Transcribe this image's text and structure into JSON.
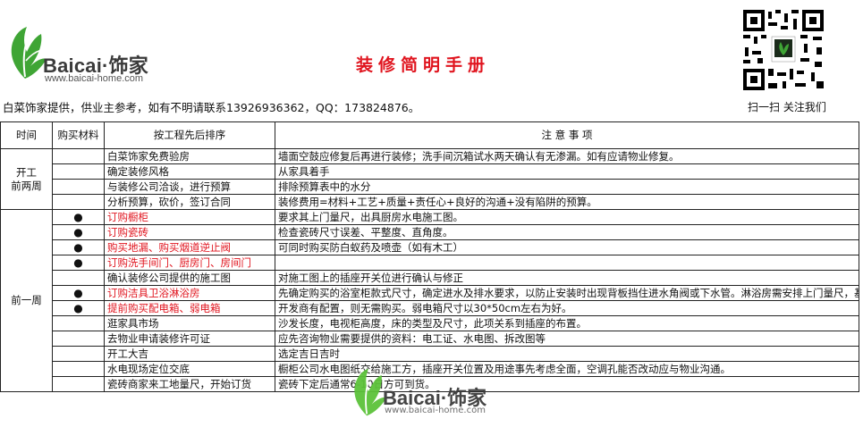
{
  "header": {
    "logo_text": "Baicai·饰家",
    "logo_url": "www.baicai-home.com",
    "title": "装修简明手册",
    "provider_note": "白菜饰家提供，供业主参考，如有不明请联系13926936362，QQ：173824876。",
    "qr_caption": "扫一扫 关注我们"
  },
  "table": {
    "headers": [
      "时间",
      "购买材料",
      "按工程先后排序",
      "注 意 事 项"
    ],
    "periods": [
      "开工\n前两周",
      "前一周"
    ],
    "rows": [
      {
        "purchase": false,
        "item": "白菜饰家免费验房",
        "red": false,
        "note": "墙面空鼓应修复后再进行装修；洗手间沉箱试水两天确认有无渗漏。如有应请物业修复。"
      },
      {
        "purchase": false,
        "item": "确定装修风格",
        "red": false,
        "note": "从家具着手"
      },
      {
        "purchase": false,
        "item": "与装修公司洽谈，进行预算",
        "red": false,
        "note": "排除预算表中的水分"
      },
      {
        "purchase": false,
        "item": "分析预算，砍价，签订合同",
        "red": false,
        "note": "装修费用=材料+工艺+质量+责任心+良好的沟通+没有陷阱的预算。"
      },
      {
        "purchase": true,
        "item": "订购橱柜",
        "red": true,
        "note": "要求其上门量尺，出具厨房水电施工图。"
      },
      {
        "purchase": true,
        "item": "订购瓷砖",
        "red": true,
        "note": "检查瓷砖尺寸误差、平整度、直角度。"
      },
      {
        "purchase": true,
        "item": "购买地漏、购买烟道逆止阀",
        "red": true,
        "note": "可同时购买防白蚁药及喷壶（如有木工）"
      },
      {
        "purchase": true,
        "item": "订购洗手间门、厨房门、房间门",
        "red": true,
        "note": ""
      },
      {
        "purchase": false,
        "item": "确认装修公司提供的施工图",
        "red": false,
        "note": "对施工图上的插座开关位进行确认与修正"
      },
      {
        "purchase": true,
        "item": "订购洁具卫浴淋浴房",
        "red": true,
        "note": "先确定购买的浴室柜款式尺寸，确定进水及排水要求，以防止安装时出现背板挡住进水角阀或下水管。淋浴房需安排上门量尺，基石要预先安排制作。"
      },
      {
        "purchase": true,
        "item": "提前购买配电箱、弱电箱",
        "red": true,
        "note": "开发商有配置，则无需购买。弱电箱尺寸以30*50cm左右为好。"
      },
      {
        "purchase": false,
        "item": "逛家具市场",
        "red": false,
        "note": "沙发长度，电视柜高度，床的类型及尺寸，此项关系到插座的布置。"
      },
      {
        "purchase": false,
        "item": "去物业申请装修许可证",
        "red": false,
        "note": "应先咨询物业需要提供的资料：电工证、水电图、拆改图等"
      },
      {
        "purchase": false,
        "item": "开工大吉",
        "red": false,
        "note": "选定吉日吉时"
      },
      {
        "purchase": false,
        "item": "水电现场定位交底",
        "red": false,
        "note": "橱柜公司水电图纸交给施工方，插座开关位置及用途事先考虑全面，空调孔能否改动应与物业沟通。"
      },
      {
        "purchase": false,
        "item": "瓷砖商家来工地量尺，开始订货",
        "red": false,
        "note": "瓷砖下定后通常6-10日方可到货。"
      }
    ]
  },
  "watermark": {
    "text": "Baicai·饰家",
    "url": "www.baicai-home.com"
  },
  "colors": {
    "title": "#e0141e",
    "logo_green": "#3fa535",
    "text": "#111111"
  },
  "icons": {
    "logo": "cabbage-leaf-icon",
    "qr": "qr-code-icon",
    "bullet": "filled-circle-icon"
  }
}
